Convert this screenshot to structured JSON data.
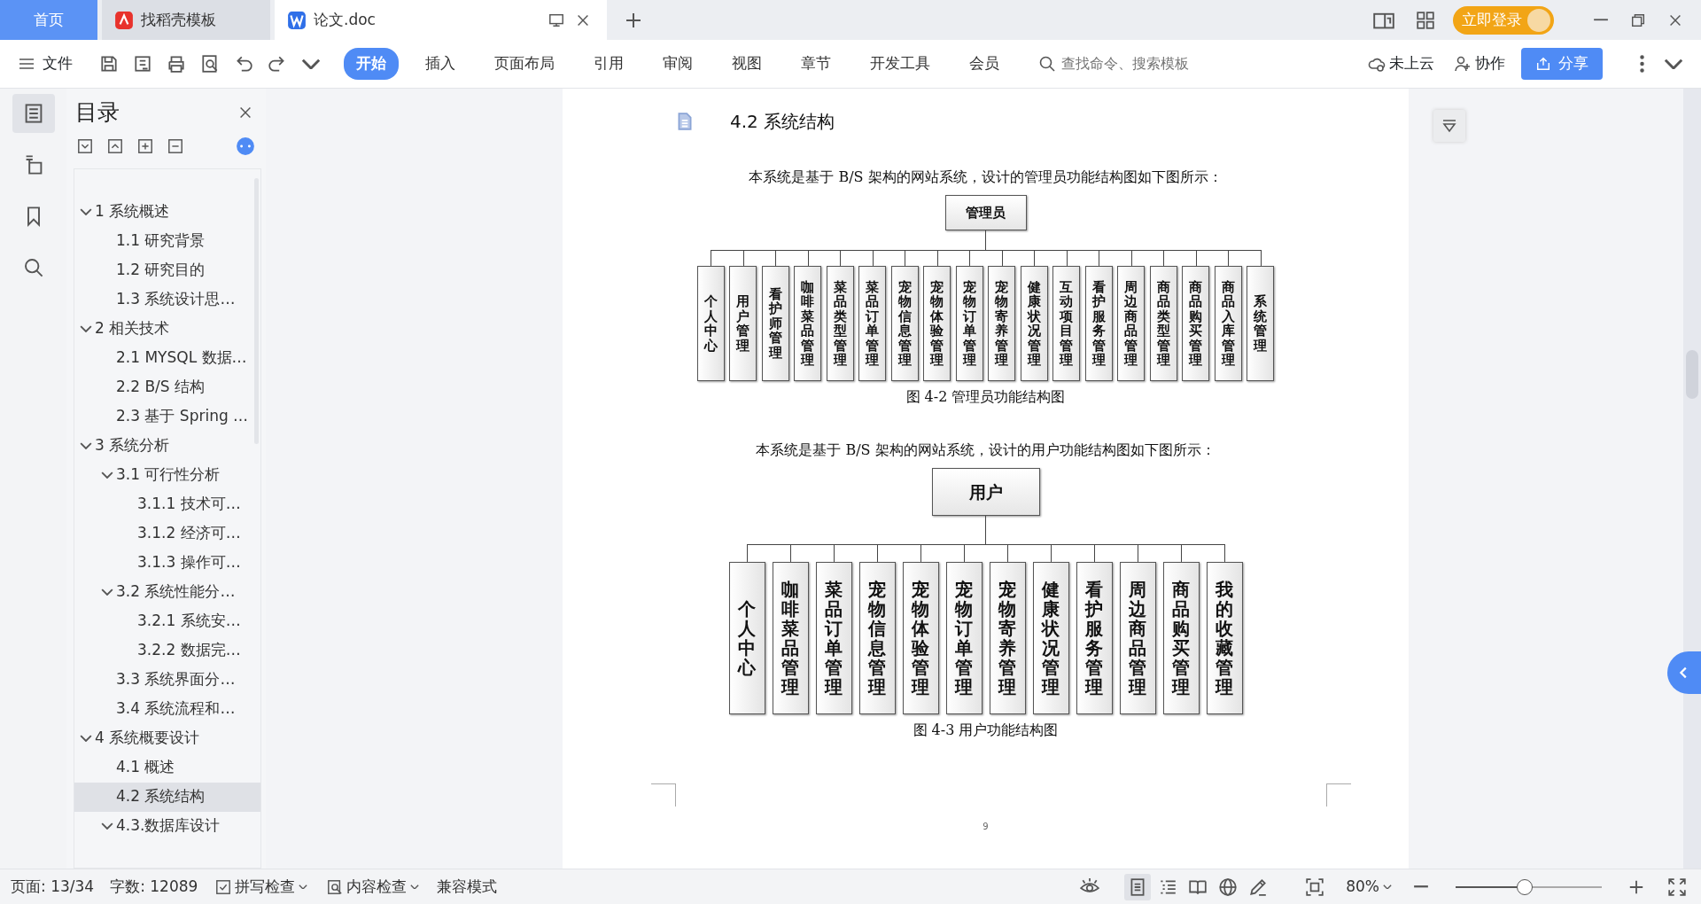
{
  "tabs": [
    {
      "label": "首页",
      "kind": "home",
      "selected": false
    },
    {
      "label": "找稻壳模板",
      "kind": "template",
      "selected": false
    },
    {
      "label": "论文.doc",
      "kind": "doc",
      "selected": true
    }
  ],
  "login_button": "立即登录",
  "toolbar": {
    "file_menu": "文件",
    "ribbon_tabs": [
      {
        "label": "开始",
        "selected": true
      },
      {
        "label": "插入",
        "selected": false
      },
      {
        "label": "页面布局",
        "selected": false
      },
      {
        "label": "引用",
        "selected": false
      },
      {
        "label": "审阅",
        "selected": false
      },
      {
        "label": "视图",
        "selected": false
      },
      {
        "label": "章节",
        "selected": false
      },
      {
        "label": "开发工具",
        "selected": false
      },
      {
        "label": "会员",
        "selected": false
      }
    ],
    "search": {
      "placeholder": "查找命令、搜索模板"
    },
    "cloud": "未上云",
    "collab": "协作",
    "share": "分享"
  },
  "left_rail": [
    {
      "kind": "toc",
      "selected": true
    },
    {
      "kind": "nav",
      "selected": false
    },
    {
      "kind": "bookmark",
      "selected": false
    },
    {
      "kind": "search",
      "selected": false
    }
  ],
  "sidebar": {
    "title": "目录",
    "toc": [
      {
        "label": "1 系统概述",
        "expanded": true,
        "selected": false,
        "children": [
          {
            "label": "1.1  研究背景",
            "selected": false
          },
          {
            "label": "1.2 研究目的",
            "selected": false
          },
          {
            "label": "1.3 系统设计思…",
            "selected": false
          }
        ]
      },
      {
        "label": "2 相关技术",
        "expanded": true,
        "selected": false,
        "children": [
          {
            "label": "2.1 MYSQL 数据…",
            "selected": false
          },
          {
            "label": "2.2 B/S 结构",
            "selected": false
          },
          {
            "label": "2.3  基于 Spring …",
            "selected": false
          }
        ]
      },
      {
        "label": "3 系统分析",
        "expanded": true,
        "selected": false,
        "children": [
          {
            "label": "3.1 可行性分析",
            "expanded": true,
            "selected": false,
            "children": [
              {
                "label": "3.1.1 技术可…",
                "selected": false
              },
              {
                "label": "3.1.2 经济可…",
                "selected": false
              },
              {
                "label": "3.1.3 操作可…",
                "selected": false
              }
            ]
          },
          {
            "label": "3.2 系统性能分…",
            "expanded": true,
            "selected": false,
            "children": [
              {
                "label": "3.2.1  系统安…",
                "selected": false
              },
              {
                "label": "3.2.2  数据完…",
                "selected": false
              }
            ]
          },
          {
            "label": "3.3 系统界面分…",
            "selected": false
          },
          {
            "label": "3.4 系统流程和…",
            "selected": false
          }
        ]
      },
      {
        "label": "4 系统概要设计",
        "expanded": true,
        "selected": false,
        "children": [
          {
            "label": "4.1 概述",
            "selected": false
          },
          {
            "label": "4.2 系统结构",
            "selected": true
          },
          {
            "label": "4.3.数据库设计",
            "expanded": true,
            "selected": false
          }
        ]
      }
    ]
  },
  "document": {
    "heading": "4.2 系统结构",
    "blocks": [
      {
        "kind": "paragraph",
        "text": "本系统是基于 B/S 架构的网站系统，设计的管理员功能结构图如下图所示："
      },
      {
        "kind": "chart",
        "root": "管理员",
        "nodes": [
          "个人中心",
          "用户管理",
          "看护师管理",
          "咖啡菜品管理",
          "菜品类型管理",
          "菜品订单管理",
          "宠物信息管理",
          "宠物体验管理",
          "宠物订单管理",
          "宠物寄养管理",
          "健康状况管理",
          "互动项目管理",
          "看护服务管理",
          "周边商品管理",
          "商品类型管理",
          "商品购买管理",
          "商品入库管理",
          "系统管理"
        ]
      },
      {
        "kind": "caption",
        "text": "图 4-2 管理员功能结构图"
      },
      {
        "kind": "paragraph",
        "text": "本系统是基于 B/S 架构的网站系统，设计的用户功能结构图如下图所示："
      },
      {
        "kind": "chart",
        "root": "用户",
        "nodes": [
          "个人中心",
          "咖啡菜品管理",
          "菜品订单管理",
          "宠物信息管理",
          "宠物体验管理",
          "宠物订单管理",
          "宠物寄养管理",
          "健康状况管理",
          "看护服务管理",
          "周边商品管理",
          "商品购买管理",
          "我的收藏管理"
        ]
      },
      {
        "kind": "caption",
        "text": "图 4-3 用户功能结构图"
      }
    ],
    "page_number": "9"
  },
  "status_bar": {
    "page": "页面: 13/34",
    "words": "字数: 12089",
    "spell_check": "拼写检查",
    "content_check": "内容检查",
    "mode": "兼容模式",
    "views": [
      {
        "kind": "eye",
        "selected": false
      },
      {
        "kind": "page",
        "selected": true
      },
      {
        "kind": "outline",
        "selected": false
      },
      {
        "kind": "read",
        "selected": false
      },
      {
        "kind": "web",
        "selected": false
      },
      {
        "kind": "pen",
        "selected": false
      }
    ],
    "zoom": "80%",
    "zoom_slider": {
      "level": 0.47
    }
  }
}
